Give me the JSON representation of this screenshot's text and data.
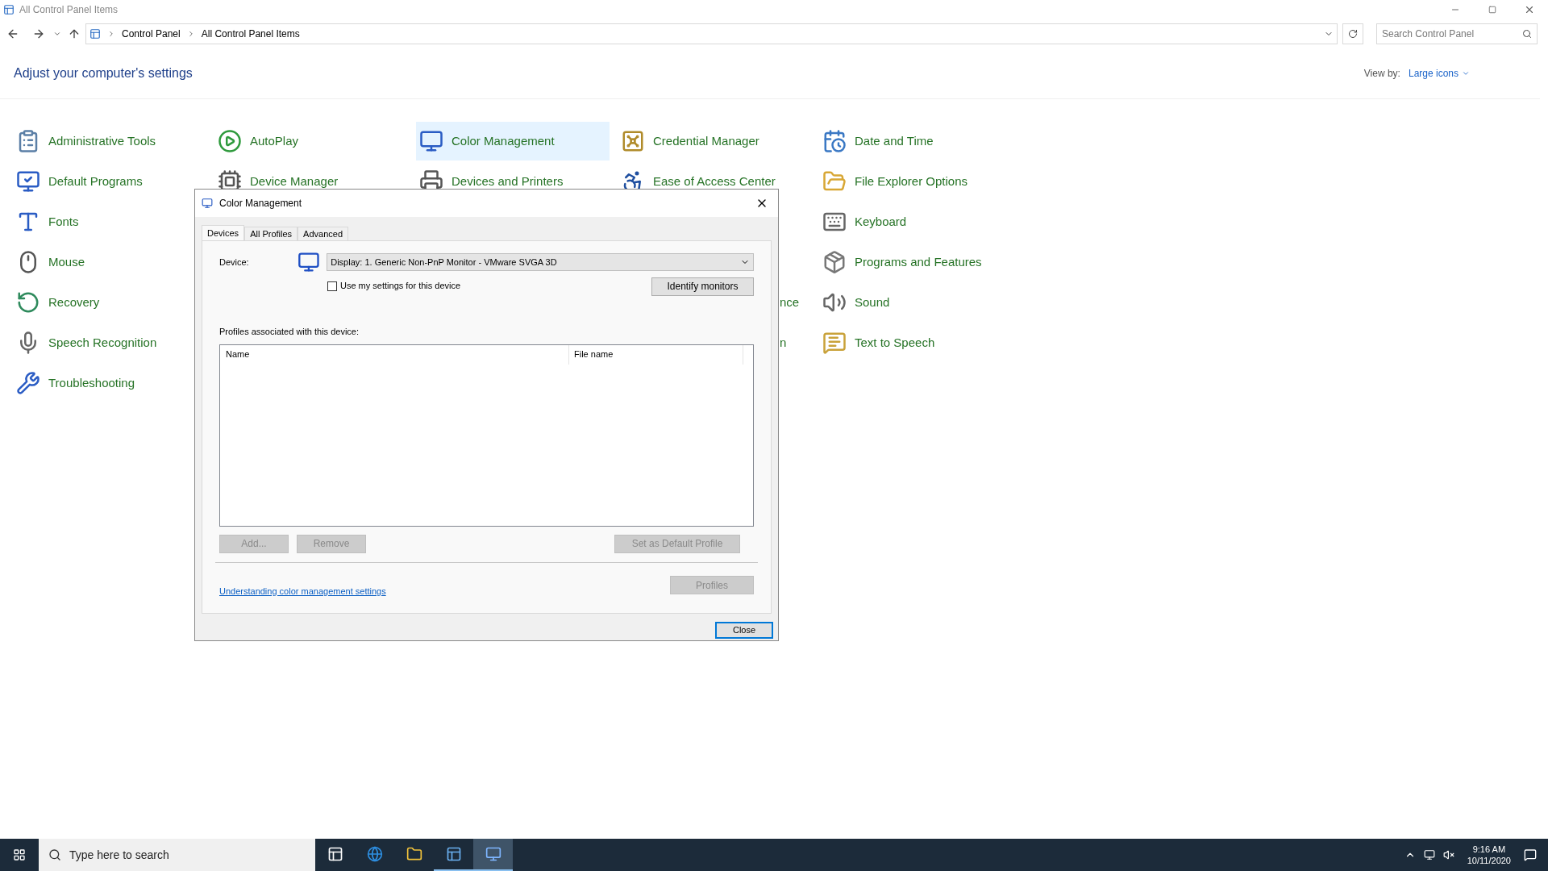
{
  "window": {
    "title": "All Control Panel Items"
  },
  "address_bar": {
    "breadcrumbs": [
      "Control Panel",
      "All Control Panel Items"
    ]
  },
  "search": {
    "placeholder": "Search Control Panel"
  },
  "heading": "Adjust your computer's settings",
  "view_by": {
    "label": "View by:",
    "value": "Large icons"
  },
  "items": [
    {
      "kind": "item",
      "label": "Administrative Tools",
      "selected": false
    },
    {
      "kind": "item",
      "label": "AutoPlay",
      "selected": false
    },
    {
      "kind": "item",
      "label": "Color Management",
      "selected": true
    },
    {
      "kind": "item",
      "label": "Credential Manager",
      "selected": false
    },
    {
      "kind": "item",
      "label": "Date and Time",
      "selected": false
    },
    {
      "kind": "item",
      "label": "Default Programs",
      "selected": false
    },
    {
      "kind": "item",
      "label": "Device Manager",
      "selected": false
    },
    {
      "kind": "item",
      "label": "Devices and Printers",
      "selected": false
    },
    {
      "kind": "item",
      "label": "Ease of Access Center",
      "selected": false
    },
    {
      "kind": "item",
      "label": "File Explorer Options",
      "selected": false
    },
    {
      "kind": "item",
      "label": "Fonts",
      "selected": false
    },
    {
      "kind": "covered"
    },
    {
      "kind": "covered"
    },
    {
      "kind": "covered"
    },
    {
      "kind": "item",
      "label": "Keyboard",
      "selected": false
    },
    {
      "kind": "item",
      "label": "Mouse",
      "selected": false
    },
    {
      "kind": "covered"
    },
    {
      "kind": "covered"
    },
    {
      "kind": "covered"
    },
    {
      "kind": "item",
      "label": "Programs and Features",
      "selected": false
    },
    {
      "kind": "item",
      "label": "Recovery",
      "selected": false
    },
    {
      "kind": "covered"
    },
    {
      "kind": "covered"
    },
    {
      "kind": "fragment",
      "label": "nce"
    },
    {
      "kind": "item",
      "label": "Sound",
      "selected": false
    },
    {
      "kind": "item",
      "label": "Speech Recognition",
      "selected": false
    },
    {
      "kind": "covered"
    },
    {
      "kind": "covered"
    },
    {
      "kind": "fragment",
      "label": "n"
    },
    {
      "kind": "item",
      "label": "Text to Speech",
      "selected": false
    },
    {
      "kind": "item",
      "label": "Troubleshooting",
      "selected": false
    }
  ],
  "dialog": {
    "title": "Color Management",
    "tabs": [
      {
        "label": "Devices",
        "selected": true
      },
      {
        "label": "All Profiles",
        "selected": false
      },
      {
        "label": "Advanced",
        "selected": false
      }
    ],
    "device_label": "Device:",
    "device_value": "Display: 1. Generic Non-PnP Monitor - VMware SVGA 3D",
    "use_my_settings": {
      "label": "Use my settings for this device",
      "checked": false
    },
    "identify_button": {
      "label": "Identify monitors",
      "disabled": false
    },
    "profiles_label": "Profiles associated with this device:",
    "columns": [
      "Name",
      "File name"
    ],
    "list_buttons": [
      {
        "label": "Add...",
        "disabled": true
      },
      {
        "label": "Remove",
        "disabled": true
      },
      {
        "label": "Set as Default Profile",
        "disabled": true
      }
    ],
    "link": "Understanding color management settings",
    "profiles_button": {
      "label": "Profiles",
      "disabled": true
    },
    "close_button": {
      "label": "Close",
      "disabled": false
    }
  },
  "taskbar": {
    "search_placeholder": "Type here to search",
    "apps": [
      {
        "active": false
      },
      {
        "active": false
      },
      {
        "active": false
      },
      {
        "active": true
      },
      {
        "active": true
      }
    ],
    "time": "9:16 AM",
    "date": "10/11/2020"
  }
}
